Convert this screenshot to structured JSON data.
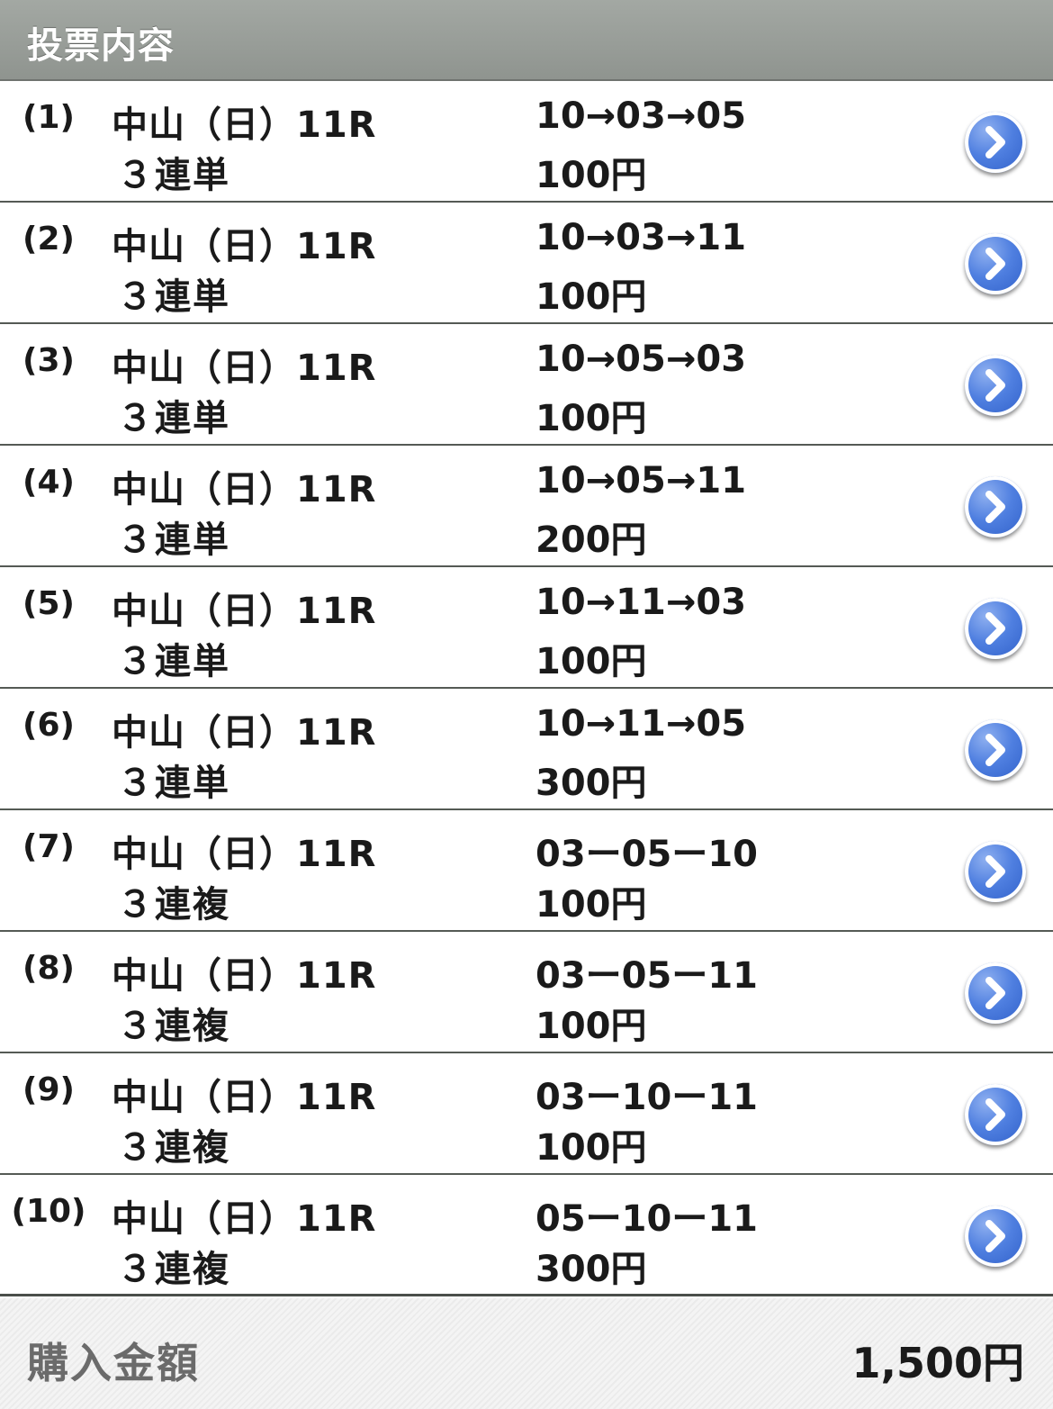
{
  "header": {
    "title": "投票内容"
  },
  "bets": [
    {
      "index": "(1)",
      "venue": "中山（日）11R",
      "bet_type": "３連単",
      "combination": "10→03→05",
      "amount": "100円"
    },
    {
      "index": "(2)",
      "venue": "中山（日）11R",
      "bet_type": "３連単",
      "combination": "10→03→11",
      "amount": "100円"
    },
    {
      "index": "(3)",
      "venue": "中山（日）11R",
      "bet_type": "３連単",
      "combination": "10→05→03",
      "amount": "100円"
    },
    {
      "index": "(4)",
      "venue": "中山（日）11R",
      "bet_type": "３連単",
      "combination": "10→05→11",
      "amount": "200円"
    },
    {
      "index": "(5)",
      "venue": "中山（日）11R",
      "bet_type": "３連単",
      "combination": "10→11→03",
      "amount": "100円"
    },
    {
      "index": "(6)",
      "venue": "中山（日）11R",
      "bet_type": "３連単",
      "combination": "10→11→05",
      "amount": "300円"
    },
    {
      "index": "(7)",
      "venue": "中山（日）11R",
      "bet_type": "３連複",
      "combination": "03ー05ー10",
      "amount": "100円"
    },
    {
      "index": "(8)",
      "venue": "中山（日）11R",
      "bet_type": "３連複",
      "combination": "03ー05ー11",
      "amount": "100円"
    },
    {
      "index": "(9)",
      "venue": "中山（日）11R",
      "bet_type": "３連複",
      "combination": "03ー10ー11",
      "amount": "100円"
    },
    {
      "index": "(10)",
      "venue": "中山（日）11R",
      "bet_type": "３連複",
      "combination": "05ー10ー11",
      "amount": "300円"
    }
  ],
  "footer": {
    "label": "購入金額",
    "total": "1,500円"
  },
  "colors": {
    "accent": "#4f7fe0",
    "header_bg": "#989d98"
  },
  "icons": {
    "row_action": "chevron-right-icon"
  }
}
